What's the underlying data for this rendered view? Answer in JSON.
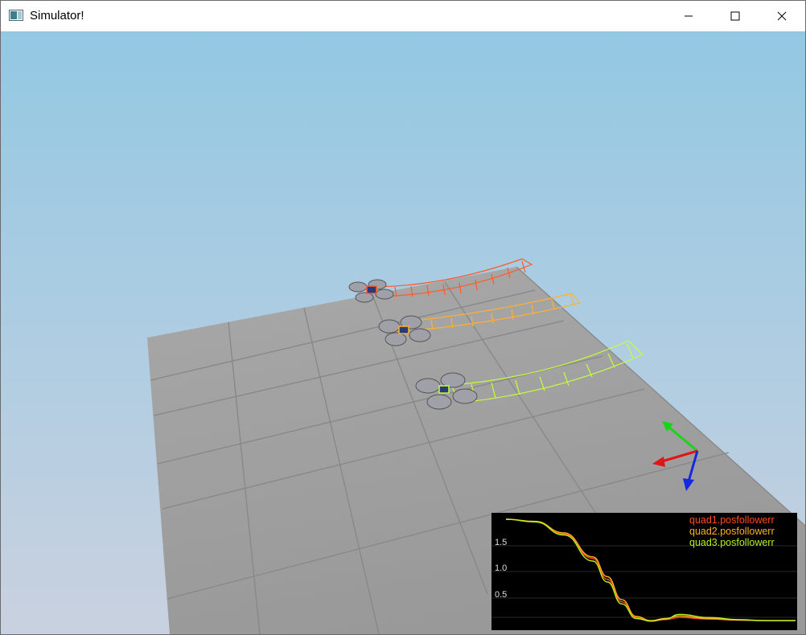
{
  "window": {
    "title": "Simulator!",
    "controls": {
      "minimize": "minimize",
      "maximize": "maximize",
      "close": "close"
    }
  },
  "scene": {
    "sky_top_color": "#93c8e3",
    "sky_bottom_color": "#c9d1e0",
    "ground_color": "#9e9e9e",
    "grid_line_color": "#868686",
    "quads": [
      {
        "name": "quad1",
        "color": "#ff5a2a"
      },
      {
        "name": "quad2",
        "color": "#ffb030"
      },
      {
        "name": "quad3",
        "color": "#c6ff3a"
      }
    ],
    "axes": {
      "x_color": "#e01515",
      "y_color": "#18d418",
      "z_color": "#1528e0"
    }
  },
  "plot": {
    "background": "#000000",
    "legend": [
      {
        "label": "quad1.posfollowerr",
        "color": "#ff4a1f"
      },
      {
        "label": "quad2.posfollowerr",
        "color": "#ffb020"
      },
      {
        "label": "quad3.posfollowerr",
        "color": "#b6f020"
      }
    ],
    "y_ticks": [
      "1.5",
      "1.0",
      "0.5"
    ]
  },
  "chart_data": {
    "type": "line",
    "title": "",
    "xlabel": "",
    "ylabel": "",
    "ylim": [
      0,
      2.0
    ],
    "x": [
      0,
      0.1,
      0.2,
      0.3,
      0.35,
      0.4,
      0.45,
      0.5,
      0.55,
      0.6,
      0.7,
      0.8,
      0.9,
      1.0
    ],
    "series": [
      {
        "name": "quad1.posfollowerr",
        "values": [
          2.0,
          1.95,
          1.72,
          1.25,
          0.85,
          0.42,
          0.12,
          0.05,
          0.08,
          0.12,
          0.09,
          0.07,
          0.06,
          0.06
        ]
      },
      {
        "name": "quad2.posfollowerr",
        "values": [
          2.0,
          1.96,
          1.74,
          1.28,
          0.9,
          0.46,
          0.14,
          0.06,
          0.1,
          0.15,
          0.1,
          0.07,
          0.06,
          0.06
        ]
      },
      {
        "name": "quad3.posfollowerr",
        "values": [
          2.0,
          1.95,
          1.7,
          1.2,
          0.8,
          0.38,
          0.1,
          0.05,
          0.09,
          0.18,
          0.12,
          0.08,
          0.06,
          0.06
        ]
      }
    ]
  }
}
